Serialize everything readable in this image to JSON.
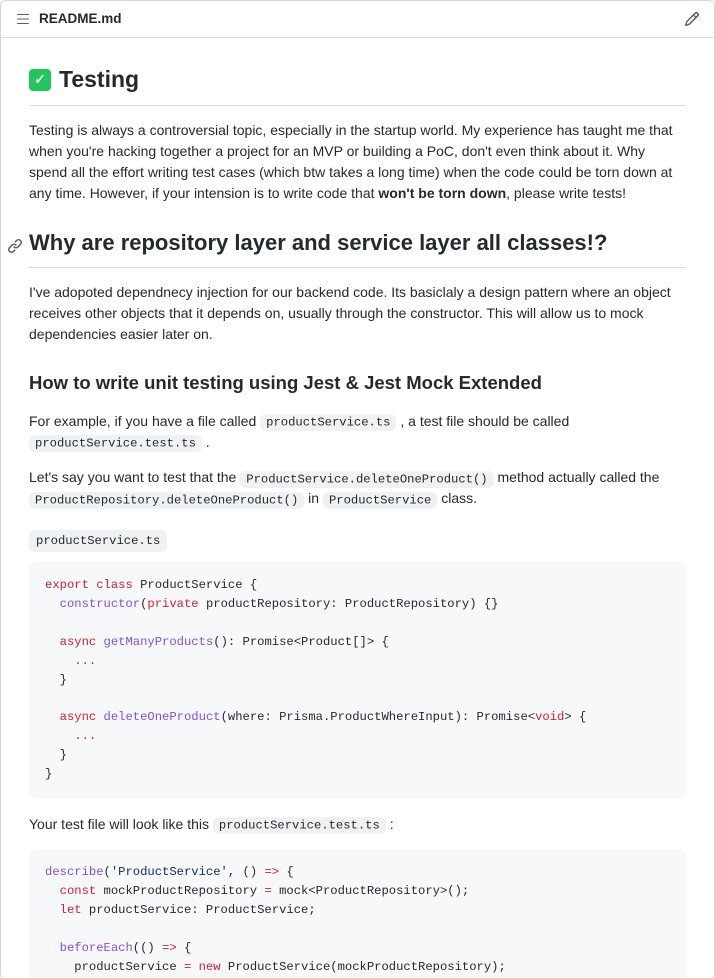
{
  "header": {
    "filename": "README.md"
  },
  "doc": {
    "title": "Testing",
    "intro_part1": "Testing is always a controversial topic, especially in the startup world. My experience has taught me that when you're hacking together a project for an MVP or building a PoC, don't even think about it. Why spend all the effort writing test cases (which btw takes a long time) when the code could be torn down at any time. However, if your intension is to write code that ",
    "intro_bold": "won't be torn down",
    "intro_part2": ", please write tests!",
    "h2_why": "Why are repository layer and service layer all classes!?",
    "why_body": "I've adopoted dependnecy injection for our backend code. Its basiclaly a design pattern where an object receives other objects that it depends on, usually through the constructor. This will allow us to mock dependencies easier later on.",
    "h3_howto": "How to write unit testing using Jest & Jest Mock Extended",
    "example_prefix": "For example, if you have a file called ",
    "code_service": "productService.ts",
    "example_mid": " , a test file should be called ",
    "code_test": "productService.test.ts",
    "example_suffix": " .",
    "lets_say_prefix": "Let's say you want to test that the ",
    "code_delete_call": "ProductService.deleteOneProduct()",
    "lets_say_mid": " method actually called the ",
    "code_repo_delete": "ProductRepository.deleteOneProduct()",
    "lets_say_in": " in ",
    "code_ps_class": "ProductService",
    "lets_say_suffix": " class.",
    "label_service_file": "productService.ts",
    "your_test_prefix": "Your test file will look like this ",
    "label_test_file": "productService.test.ts",
    "your_test_suffix": " :"
  },
  "code1": {
    "l1_export": "export",
    "l1_class": "class",
    "l1_name": " ProductService {",
    "l2_ctor": "constructor",
    "l2_priv": "private",
    "l2_rest": " productRepository: ProductRepository) {}",
    "l3_async": "async",
    "l3_fn": "getManyProducts",
    "l3_sig": "(): Promise<Product[]> {",
    "l3_dots": "...",
    "l4_async": "async",
    "l4_fn": "deleteOneProduct",
    "l4_sig_a": "(where: Prisma.ProductWhereInput): Promise<",
    "l4_void": "void",
    "l4_sig_b": "> {",
    "l4_dots": "..."
  },
  "code2": {
    "l1_desc": "describe",
    "l1_str": "'ProductService'",
    "l1_arrow": ", () ",
    "l1_fat": "=>",
    "l1_open": " {",
    "l2_const": "const",
    "l2_rest_a": " mockProductRepository ",
    "l2_eq": "=",
    "l2_rest_b": " mock<ProductRepository>();",
    "l3_let": "let",
    "l3_rest": " productService: ProductService;",
    "l4_be": "beforeEach",
    "l4_arrow": "(() ",
    "l4_fat": "=>",
    "l4_open": " {",
    "l5_lhs": "    productService ",
    "l5_eq": "=",
    "l5_new": "new",
    "l5_rhs": " ProductService(mockProductRepository);"
  }
}
